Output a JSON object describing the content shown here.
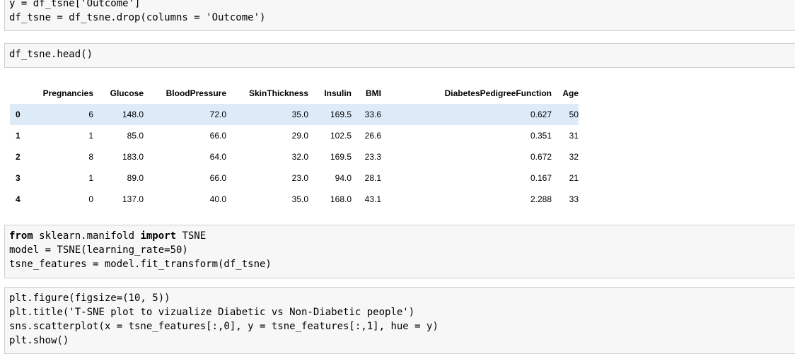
{
  "cells": [
    {
      "lines": [
        [
          {
            "t": "y = df_tsne['Outcome']"
          }
        ],
        [
          {
            "t": "df_tsne = df_tsne.drop(columns = 'Outcome')"
          }
        ]
      ]
    },
    {
      "lines": [
        [
          {
            "t": "df_tsne.head()"
          }
        ]
      ]
    },
    {
      "lines": [
        [
          {
            "t": "from",
            "k": true
          },
          {
            "t": " sklearn.manifold "
          },
          {
            "t": "import",
            "k": true
          },
          {
            "t": " TSNE"
          }
        ],
        [
          {
            "t": "model = TSNE(learning_rate=50)"
          }
        ],
        [
          {
            "t": "tsne_features = model.fit_transform(df_tsne)"
          }
        ]
      ]
    },
    {
      "lines": [
        [
          {
            "t": "plt.figure(figsize=(10, 5))"
          }
        ],
        [
          {
            "t": "plt.title('T-SNE plot to vizualize Diabetic vs Non-Diabetic people')"
          }
        ],
        [
          {
            "t": "sns.scatterplot(x = tsne_features[:,0], y = tsne_features[:,1], hue = y)"
          }
        ],
        [
          {
            "t": "plt.show()"
          }
        ]
      ]
    }
  ],
  "table": {
    "columns": [
      "Pregnancies",
      "Glucose",
      "BloodPressure",
      "SkinThickness",
      "Insulin",
      "BMI",
      "DiabetesPedigreeFunction",
      "Age"
    ],
    "rows": [
      {
        "index": "0",
        "values": [
          "6",
          "148.0",
          "72.0",
          "35.0",
          "169.5",
          "33.6",
          "0.627",
          "50"
        ]
      },
      {
        "index": "1",
        "values": [
          "1",
          "85.0",
          "66.0",
          "29.0",
          "102.5",
          "26.6",
          "0.351",
          "31"
        ]
      },
      {
        "index": "2",
        "values": [
          "8",
          "183.0",
          "64.0",
          "32.0",
          "169.5",
          "23.3",
          "0.672",
          "32"
        ]
      },
      {
        "index": "3",
        "values": [
          "1",
          "89.0",
          "66.0",
          "23.0",
          "94.0",
          "28.1",
          "0.167",
          "21"
        ]
      },
      {
        "index": "4",
        "values": [
          "0",
          "137.0",
          "40.0",
          "35.0",
          "168.0",
          "43.1",
          "2.288",
          "33"
        ]
      }
    ],
    "highlight_row_color": "#ddebf9"
  }
}
